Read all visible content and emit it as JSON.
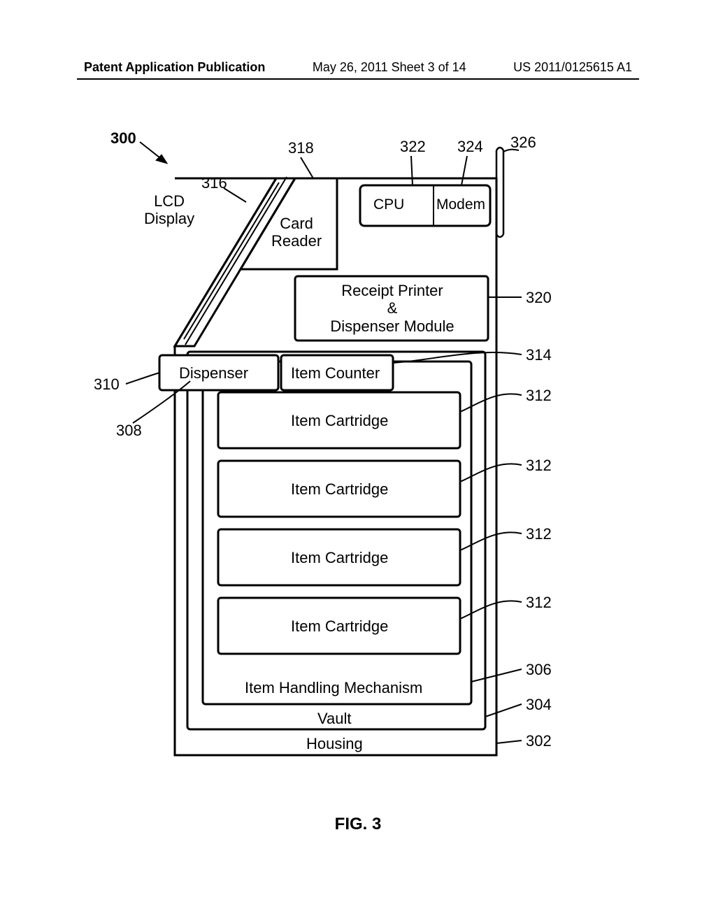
{
  "header": {
    "left": "Patent Application Publication",
    "center": "May 26, 2011  Sheet 3 of 14",
    "right": "US 2011/0125615 A1"
  },
  "figure_caption": "FIG. 3",
  "refs": {
    "r300": "300",
    "r302": "302",
    "r304": "304",
    "r306": "306",
    "r308": "308",
    "r310": "310",
    "r312": "312",
    "r314": "314",
    "r316": "316",
    "r318": "318",
    "r320": "320",
    "r322": "322",
    "r324": "324",
    "r326": "326"
  },
  "labels": {
    "lcd_display": "LCD\nDisplay",
    "card_reader": "Card\nReader",
    "cpu": "CPU",
    "modem": "Modem",
    "receipt_printer": "Receipt Printer\n&\nDispenser Module",
    "dispenser": "Dispenser",
    "item_counter": "Item Counter",
    "item_cartridge": "Item Cartridge",
    "item_handling": "Item Handling Mechanism",
    "vault": "Vault",
    "housing": "Housing"
  }
}
